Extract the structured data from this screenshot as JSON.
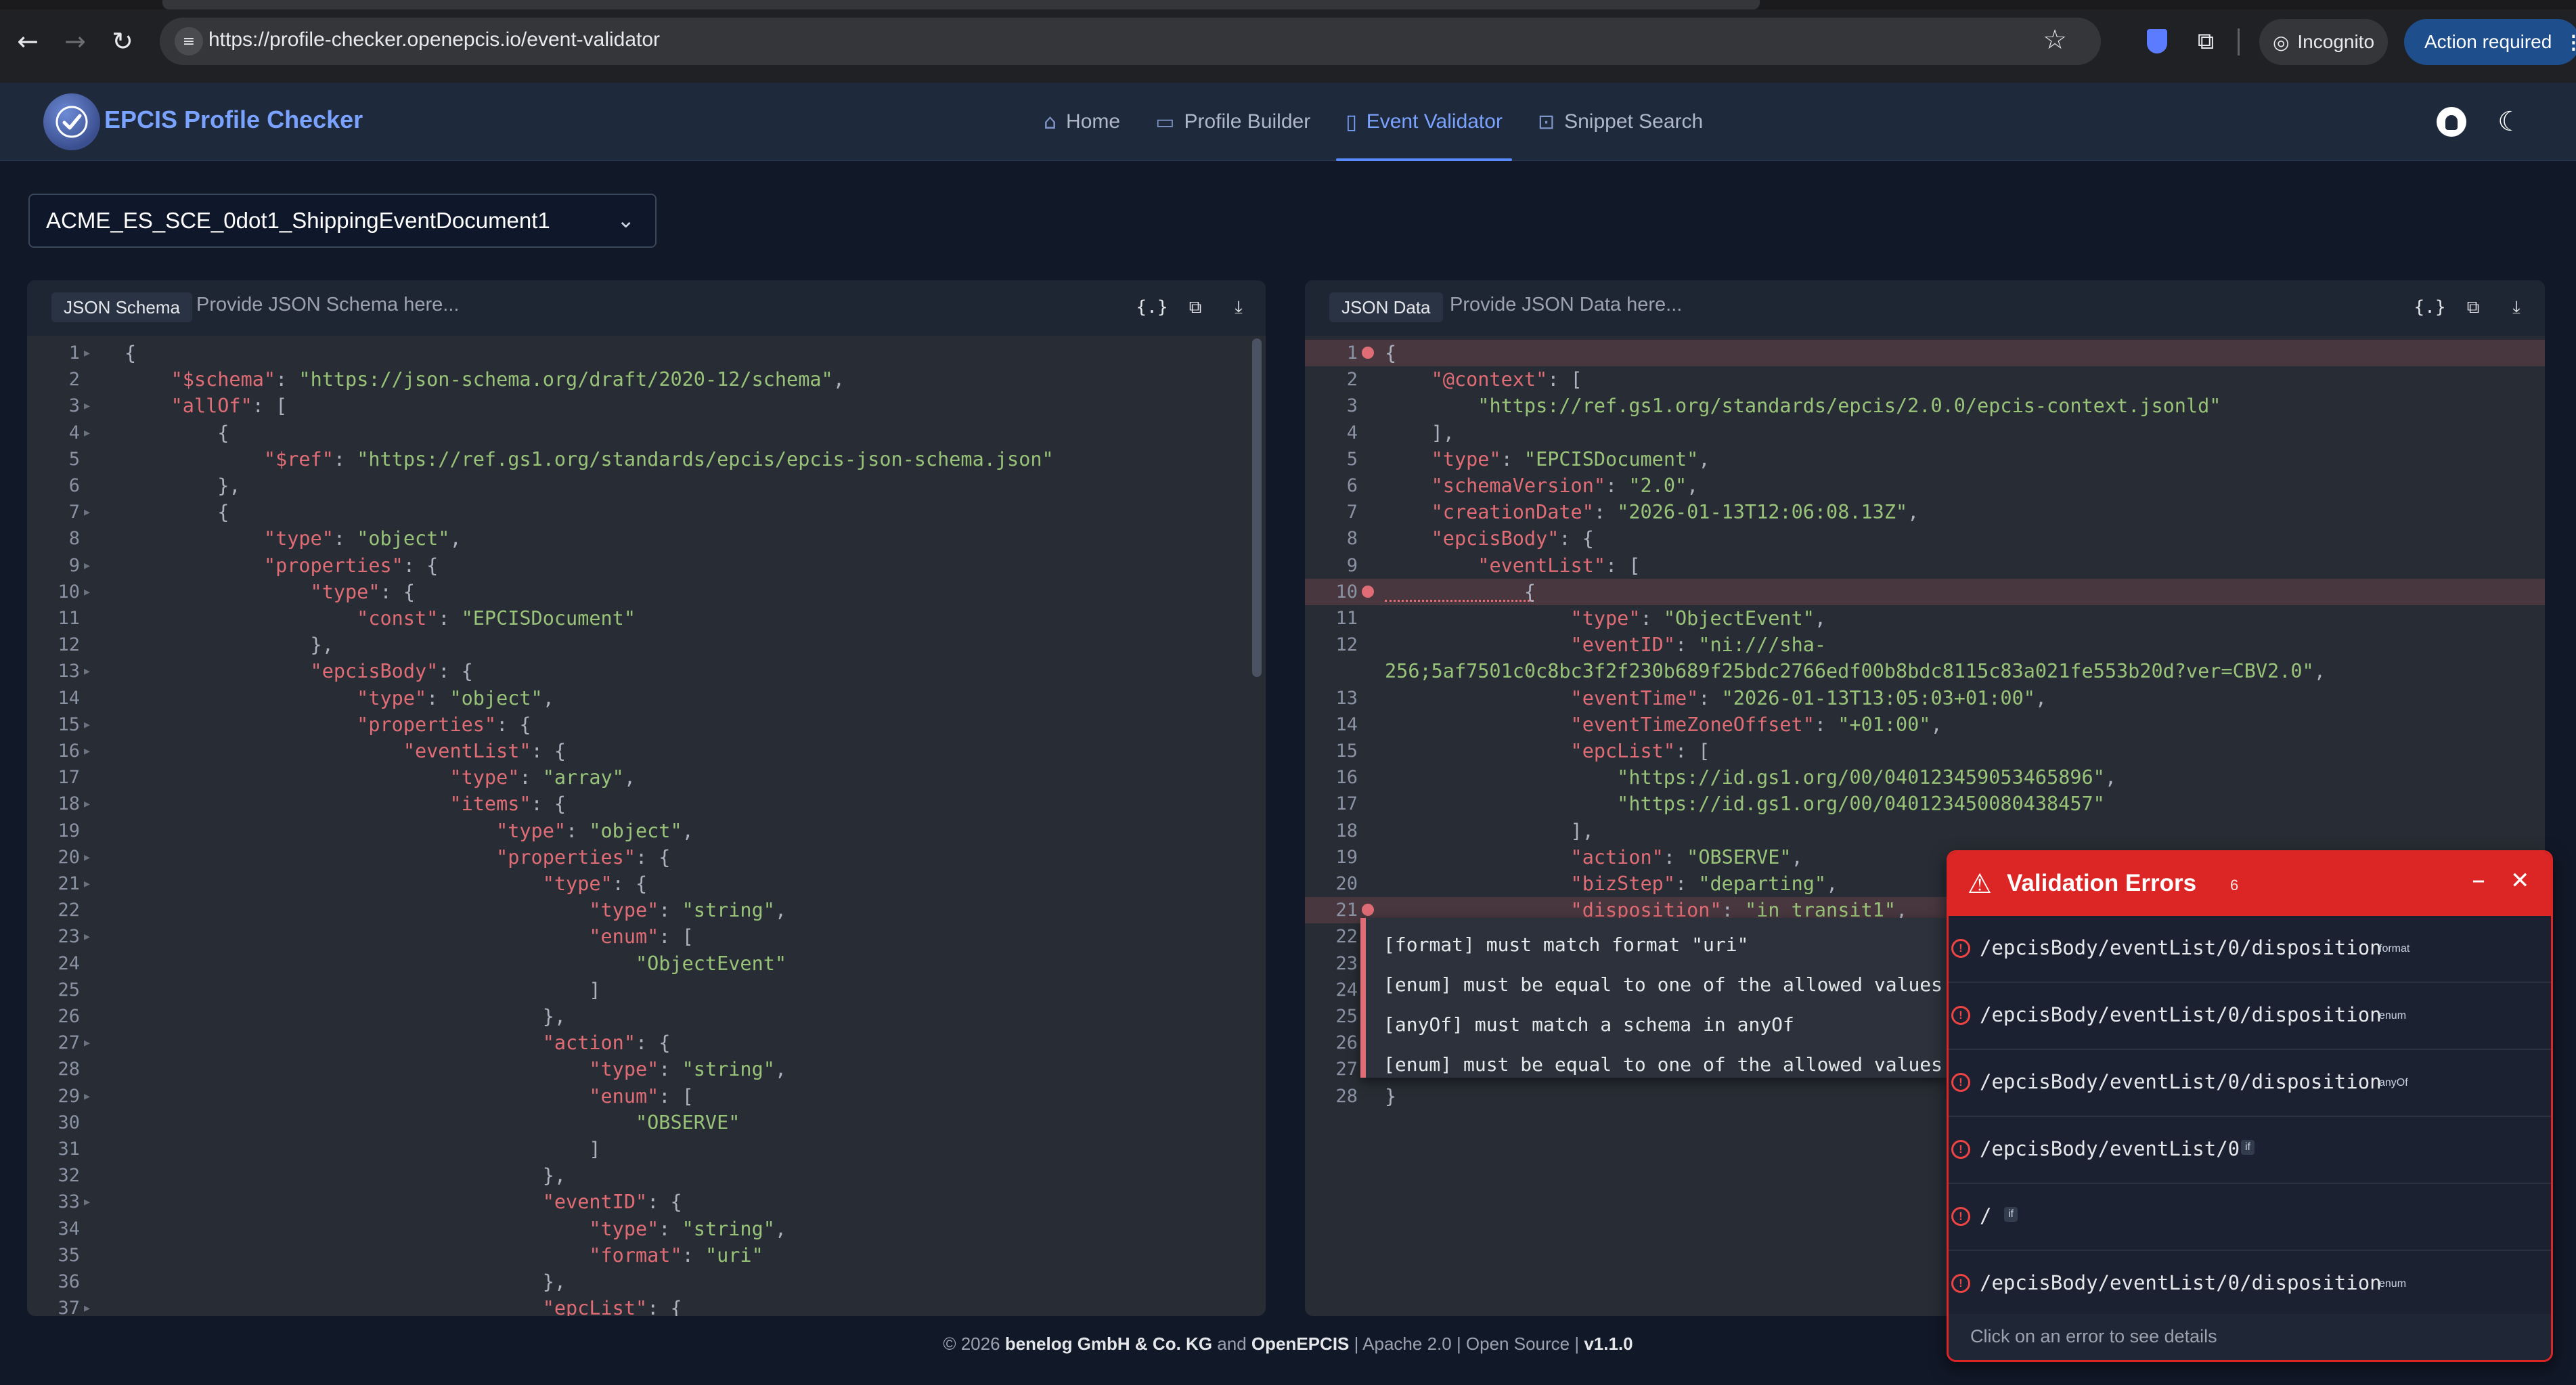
{
  "browser": {
    "url": "https://profile-checker.openepcis.io/event-validator",
    "incognito_label": "Incognito",
    "action_required_label": "Action required"
  },
  "app": {
    "brand": "EPCIS Profile Checker",
    "nav": [
      {
        "label": "Home",
        "icon": "home-icon"
      },
      {
        "label": "Profile Builder",
        "icon": "document-edit-icon"
      },
      {
        "label": "Event Validator",
        "icon": "document-check-icon",
        "active": true
      },
      {
        "label": "Snippet Search",
        "icon": "search-document-icon"
      }
    ]
  },
  "document_select": {
    "value": "ACME_ES_SCE_0dot1_ShippingEventDocument1"
  },
  "schema_panel": {
    "label": "JSON Schema",
    "placeholder": "Provide JSON Schema here...",
    "lines": [
      [
        [
          "p",
          "{"
        ]
      ],
      [
        [
          "p",
          "    "
        ],
        [
          "k",
          "\"$schema\""
        ],
        [
          "p",
          ": "
        ],
        [
          "s",
          "\"https://json-schema.org/draft/2020-12/schema\""
        ],
        [
          "p",
          ","
        ]
      ],
      [
        [
          "p",
          "    "
        ],
        [
          "k",
          "\"allOf\""
        ],
        [
          "p",
          ": ["
        ]
      ],
      [
        [
          "p",
          "        {"
        ]
      ],
      [
        [
          "p",
          "            "
        ],
        [
          "k",
          "\"$ref\""
        ],
        [
          "p",
          ": "
        ],
        [
          "s",
          "\"https://ref.gs1.org/standards/epcis/epcis-json-schema.json\""
        ]
      ],
      [
        [
          "p",
          "        },"
        ]
      ],
      [
        [
          "p",
          "        {"
        ]
      ],
      [
        [
          "p",
          "            "
        ],
        [
          "k",
          "\"type\""
        ],
        [
          "p",
          ": "
        ],
        [
          "s",
          "\"object\""
        ],
        [
          "p",
          ","
        ]
      ],
      [
        [
          "p",
          "            "
        ],
        [
          "k",
          "\"properties\""
        ],
        [
          "p",
          ": {"
        ]
      ],
      [
        [
          "p",
          "                "
        ],
        [
          "k",
          "\"type\""
        ],
        [
          "p",
          ": {"
        ]
      ],
      [
        [
          "p",
          "                    "
        ],
        [
          "k",
          "\"const\""
        ],
        [
          "p",
          ": "
        ],
        [
          "s",
          "\"EPCISDocument\""
        ]
      ],
      [
        [
          "p",
          "                },"
        ]
      ],
      [
        [
          "p",
          "                "
        ],
        [
          "k",
          "\"epcisBody\""
        ],
        [
          "p",
          ": {"
        ]
      ],
      [
        [
          "p",
          "                    "
        ],
        [
          "k",
          "\"type\""
        ],
        [
          "p",
          ": "
        ],
        [
          "s",
          "\"object\""
        ],
        [
          "p",
          ","
        ]
      ],
      [
        [
          "p",
          "                    "
        ],
        [
          "k",
          "\"properties\""
        ],
        [
          "p",
          ": {"
        ]
      ],
      [
        [
          "p",
          "                        "
        ],
        [
          "k",
          "\"eventList\""
        ],
        [
          "p",
          ": {"
        ]
      ],
      [
        [
          "p",
          "                            "
        ],
        [
          "k",
          "\"type\""
        ],
        [
          "p",
          ": "
        ],
        [
          "s",
          "\"array\""
        ],
        [
          "p",
          ","
        ]
      ],
      [
        [
          "p",
          "                            "
        ],
        [
          "k",
          "\"items\""
        ],
        [
          "p",
          ": {"
        ]
      ],
      [
        [
          "p",
          "                                "
        ],
        [
          "k",
          "\"type\""
        ],
        [
          "p",
          ": "
        ],
        [
          "s",
          "\"object\""
        ],
        [
          "p",
          ","
        ]
      ],
      [
        [
          "p",
          "                                "
        ],
        [
          "k",
          "\"properties\""
        ],
        [
          "p",
          ": {"
        ]
      ],
      [
        [
          "p",
          "                                    "
        ],
        [
          "k",
          "\"type\""
        ],
        [
          "p",
          ": {"
        ]
      ],
      [
        [
          "p",
          "                                        "
        ],
        [
          "k",
          "\"type\""
        ],
        [
          "p",
          ": "
        ],
        [
          "s",
          "\"string\""
        ],
        [
          "p",
          ","
        ]
      ],
      [
        [
          "p",
          "                                        "
        ],
        [
          "k",
          "\"enum\""
        ],
        [
          "p",
          ": ["
        ]
      ],
      [
        [
          "p",
          "                                            "
        ],
        [
          "s",
          "\"ObjectEvent\""
        ]
      ],
      [
        [
          "p",
          "                                        ]"
        ]
      ],
      [
        [
          "p",
          "                                    },"
        ]
      ],
      [
        [
          "p",
          "                                    "
        ],
        [
          "k",
          "\"action\""
        ],
        [
          "p",
          ": {"
        ]
      ],
      [
        [
          "p",
          "                                        "
        ],
        [
          "k",
          "\"type\""
        ],
        [
          "p",
          ": "
        ],
        [
          "s",
          "\"string\""
        ],
        [
          "p",
          ","
        ]
      ],
      [
        [
          "p",
          "                                        "
        ],
        [
          "k",
          "\"enum\""
        ],
        [
          "p",
          ": ["
        ]
      ],
      [
        [
          "p",
          "                                            "
        ],
        [
          "s",
          "\"OBSERVE\""
        ]
      ],
      [
        [
          "p",
          "                                        ]"
        ]
      ],
      [
        [
          "p",
          "                                    },"
        ]
      ],
      [
        [
          "p",
          "                                    "
        ],
        [
          "k",
          "\"eventID\""
        ],
        [
          "p",
          ": {"
        ]
      ],
      [
        [
          "p",
          "                                        "
        ],
        [
          "k",
          "\"type\""
        ],
        [
          "p",
          ": "
        ],
        [
          "s",
          "\"string\""
        ],
        [
          "p",
          ","
        ]
      ],
      [
        [
          "p",
          "                                        "
        ],
        [
          "k",
          "\"format\""
        ],
        [
          "p",
          ": "
        ],
        [
          "s",
          "\"uri\""
        ]
      ],
      [
        [
          "p",
          "                                    },"
        ]
      ],
      [
        [
          "p",
          "                                    "
        ],
        [
          "k",
          "\"epcList\""
        ],
        [
          "p",
          ": {"
        ]
      ]
    ]
  },
  "data_panel": {
    "label": "JSON Data",
    "placeholder": "Provide JSON Data here...",
    "lines": [
      {
        "n": "1",
        "err": true,
        "t": [
          [
            "p",
            "{"
          ]
        ]
      },
      {
        "n": "2",
        "t": [
          [
            "p",
            "    "
          ],
          [
            "k",
            "\"@context\""
          ],
          [
            "p",
            ": ["
          ]
        ]
      },
      {
        "n": "3",
        "t": [
          [
            "p",
            "        "
          ],
          [
            "s",
            "\"https://ref.gs1.org/standards/epcis/2.0.0/epcis-context.jsonld\""
          ]
        ]
      },
      {
        "n": "4",
        "t": [
          [
            "p",
            "    ],"
          ]
        ]
      },
      {
        "n": "5",
        "t": [
          [
            "p",
            "    "
          ],
          [
            "k",
            "\"type\""
          ],
          [
            "p",
            ": "
          ],
          [
            "s",
            "\"EPCISDocument\""
          ],
          [
            "p",
            ","
          ]
        ]
      },
      {
        "n": "6",
        "t": [
          [
            "p",
            "    "
          ],
          [
            "k",
            "\"schemaVersion\""
          ],
          [
            "p",
            ": "
          ],
          [
            "s",
            "\"2.0\""
          ],
          [
            "p",
            ","
          ]
        ]
      },
      {
        "n": "7",
        "t": [
          [
            "p",
            "    "
          ],
          [
            "k",
            "\"creationDate\""
          ],
          [
            "p",
            ": "
          ],
          [
            "s",
            "\"2026-01-13T12:06:08.13Z\""
          ],
          [
            "p",
            ","
          ]
        ]
      },
      {
        "n": "8",
        "t": [
          [
            "p",
            "    "
          ],
          [
            "k",
            "\"epcisBody\""
          ],
          [
            "p",
            ": {"
          ]
        ]
      },
      {
        "n": "9",
        "t": [
          [
            "p",
            "        "
          ],
          [
            "k",
            "\"eventList\""
          ],
          [
            "p",
            ": ["
          ]
        ]
      },
      {
        "n": "10",
        "err": true,
        "t": [
          [
            "p",
            "            {"
          ]
        ]
      },
      {
        "n": "11",
        "t": [
          [
            "p",
            "                "
          ],
          [
            "k",
            "\"type\""
          ],
          [
            "p",
            ": "
          ],
          [
            "s",
            "\"ObjectEvent\""
          ],
          [
            "p",
            ","
          ]
        ]
      },
      {
        "n": "12",
        "t": [
          [
            "p",
            "                "
          ],
          [
            "k",
            "\"eventID\""
          ],
          [
            "p",
            ": "
          ],
          [
            "s",
            "\"ni:///sha-"
          ]
        ]
      },
      {
        "n": "",
        "t": [
          [
            "s",
            "256;5af7501c0c8bc3f2f230b689f25bdc2766edf00b8bdc8115c83a021fe553b20d?ver=CBV2.0\""
          ],
          [
            "p",
            ","
          ]
        ]
      },
      {
        "n": "13",
        "t": [
          [
            "p",
            "                "
          ],
          [
            "k",
            "\"eventTime\""
          ],
          [
            "p",
            ": "
          ],
          [
            "s",
            "\"2026-01-13T13:05:03+01:00\""
          ],
          [
            "p",
            ","
          ]
        ]
      },
      {
        "n": "14",
        "t": [
          [
            "p",
            "                "
          ],
          [
            "k",
            "\"eventTimeZoneOffset\""
          ],
          [
            "p",
            ": "
          ],
          [
            "s",
            "\"+01:00\""
          ],
          [
            "p",
            ","
          ]
        ]
      },
      {
        "n": "15",
        "t": [
          [
            "p",
            "                "
          ],
          [
            "k",
            "\"epcList\""
          ],
          [
            "p",
            ": ["
          ]
        ]
      },
      {
        "n": "16",
        "t": [
          [
            "p",
            "                    "
          ],
          [
            "s",
            "\"https://id.gs1.org/00/040123459053465896\""
          ],
          [
            "p",
            ","
          ]
        ]
      },
      {
        "n": "17",
        "t": [
          [
            "p",
            "                    "
          ],
          [
            "s",
            "\"https://id.gs1.org/00/040123450080438457\""
          ]
        ]
      },
      {
        "n": "18",
        "t": [
          [
            "p",
            "                ],"
          ]
        ]
      },
      {
        "n": "19",
        "t": [
          [
            "p",
            "                "
          ],
          [
            "k",
            "\"action\""
          ],
          [
            "p",
            ": "
          ],
          [
            "s",
            "\"OBSERVE\""
          ],
          [
            "p",
            ","
          ]
        ]
      },
      {
        "n": "20",
        "t": [
          [
            "p",
            "                "
          ],
          [
            "k",
            "\"bizStep\""
          ],
          [
            "p",
            ": "
          ],
          [
            "s",
            "\"departing\""
          ],
          [
            "p",
            ","
          ]
        ]
      },
      {
        "n": "21",
        "err": true,
        "t": [
          [
            "p",
            "                "
          ],
          [
            "k",
            "\"disposition\""
          ],
          [
            "p",
            ": "
          ],
          [
            "s",
            "\"in_transit1\""
          ],
          [
            "p",
            ","
          ]
        ]
      },
      {
        "n": "22",
        "t": []
      },
      {
        "n": "23",
        "t": []
      },
      {
        "n": "24",
        "t": []
      },
      {
        "n": "25",
        "t": []
      },
      {
        "n": "26",
        "t": []
      },
      {
        "n": "27",
        "t": []
      },
      {
        "n": "28",
        "t": [
          [
            "p",
            "}"
          ]
        ]
      }
    ]
  },
  "tooltip": {
    "messages": [
      "[format] must match format \"uri\"",
      "[enum] must be equal to one of the allowed values",
      "[anyOf] must match a schema in anyOf",
      "[enum] must be equal to one of the allowed values"
    ]
  },
  "validation": {
    "title": "Validation Errors",
    "count": "6",
    "errors": [
      {
        "path": "/epcisBody/eventList/0/disposition",
        "keyword": "format"
      },
      {
        "path": "/epcisBody/eventList/0/disposition",
        "keyword": "enum"
      },
      {
        "path": "/epcisBody/eventList/0/disposition",
        "keyword": "anyOf"
      },
      {
        "path": "/epcisBody/eventList/0",
        "keyword": "if"
      },
      {
        "path": "/",
        "keyword": "if"
      },
      {
        "path": "/epcisBody/eventList/0/disposition",
        "keyword": "enum"
      }
    ],
    "footer_hint": "Click on an error to see details"
  },
  "footer": {
    "copyright": "© 2026",
    "company": "benelog GmbH & Co. KG",
    "and": "and",
    "org": "OpenEPCIS",
    "rest": "| Apache 2.0 | Open Source |",
    "version": "v1.1.0"
  },
  "colors": {
    "accent": "#7aa2ff",
    "error": "#dc2626",
    "editor_bg": "#282c34",
    "key": "#e06c75",
    "string": "#98c379"
  }
}
